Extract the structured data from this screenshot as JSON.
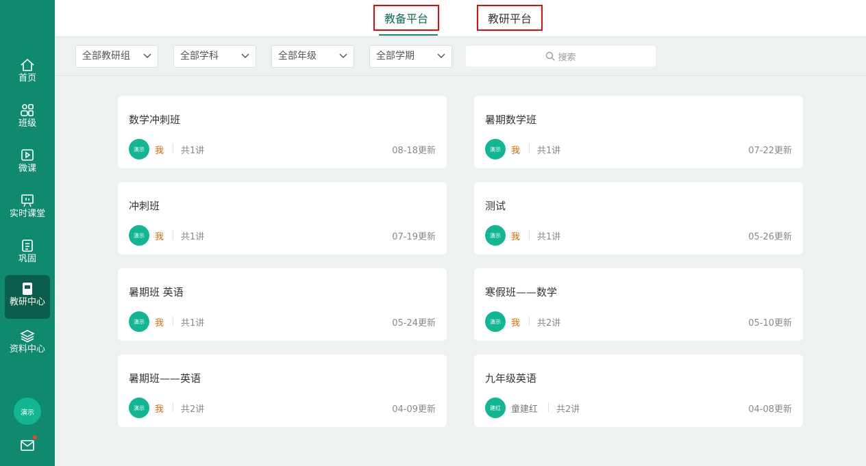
{
  "sidebar": {
    "items": [
      {
        "label": "首页",
        "icon": "home-icon"
      },
      {
        "label": "班级",
        "icon": "users-icon"
      },
      {
        "label": "微课",
        "icon": "video-icon"
      },
      {
        "label": "实时课堂",
        "icon": "classroom-icon"
      },
      {
        "label": "巩固",
        "icon": "list-icon"
      },
      {
        "label": "教研中心",
        "icon": "book-icon",
        "active": true
      },
      {
        "label": "资料中心",
        "icon": "layers-icon"
      }
    ],
    "avatar_text": "演示",
    "mail_icon": "mail-icon",
    "accent": "#0f8a6c"
  },
  "tabs": [
    {
      "label": "教备平台",
      "active": true
    },
    {
      "label": "教研平台",
      "active": false
    }
  ],
  "filters": [
    {
      "value": "全部教研组"
    },
    {
      "value": "全部学科"
    },
    {
      "value": "全部年级"
    },
    {
      "value": "全部学期"
    }
  ],
  "search": {
    "placeholder": "搜索"
  },
  "cards": [
    {
      "title": "数学冲刺班",
      "avatar": "演示",
      "author": "我",
      "count": "共1讲",
      "updated": "08-18更新"
    },
    {
      "title": "暑期数学班",
      "avatar": "演示",
      "author": "我",
      "count": "共1讲",
      "updated": "07-22更新"
    },
    {
      "title": "冲刺班",
      "avatar": "演示",
      "author": "我",
      "count": "共1讲",
      "updated": "07-19更新"
    },
    {
      "title": "测试",
      "avatar": "演示",
      "author": "我",
      "count": "共1讲",
      "updated": "05-26更新"
    },
    {
      "title": "暑期班 英语",
      "avatar": "演示",
      "author": "我",
      "count": "共1讲",
      "updated": "05-24更新"
    },
    {
      "title": "寒假班——数学",
      "avatar": "演示",
      "author": "我",
      "count": "共2讲",
      "updated": "05-10更新"
    },
    {
      "title": "暑期班——英语",
      "avatar": "演示",
      "author": "我",
      "count": "共2讲",
      "updated": "04-09更新"
    },
    {
      "title": "九年级英语",
      "avatar": "建红",
      "author": "童建红",
      "count": "共2讲",
      "updated": "04-08更新"
    }
  ]
}
